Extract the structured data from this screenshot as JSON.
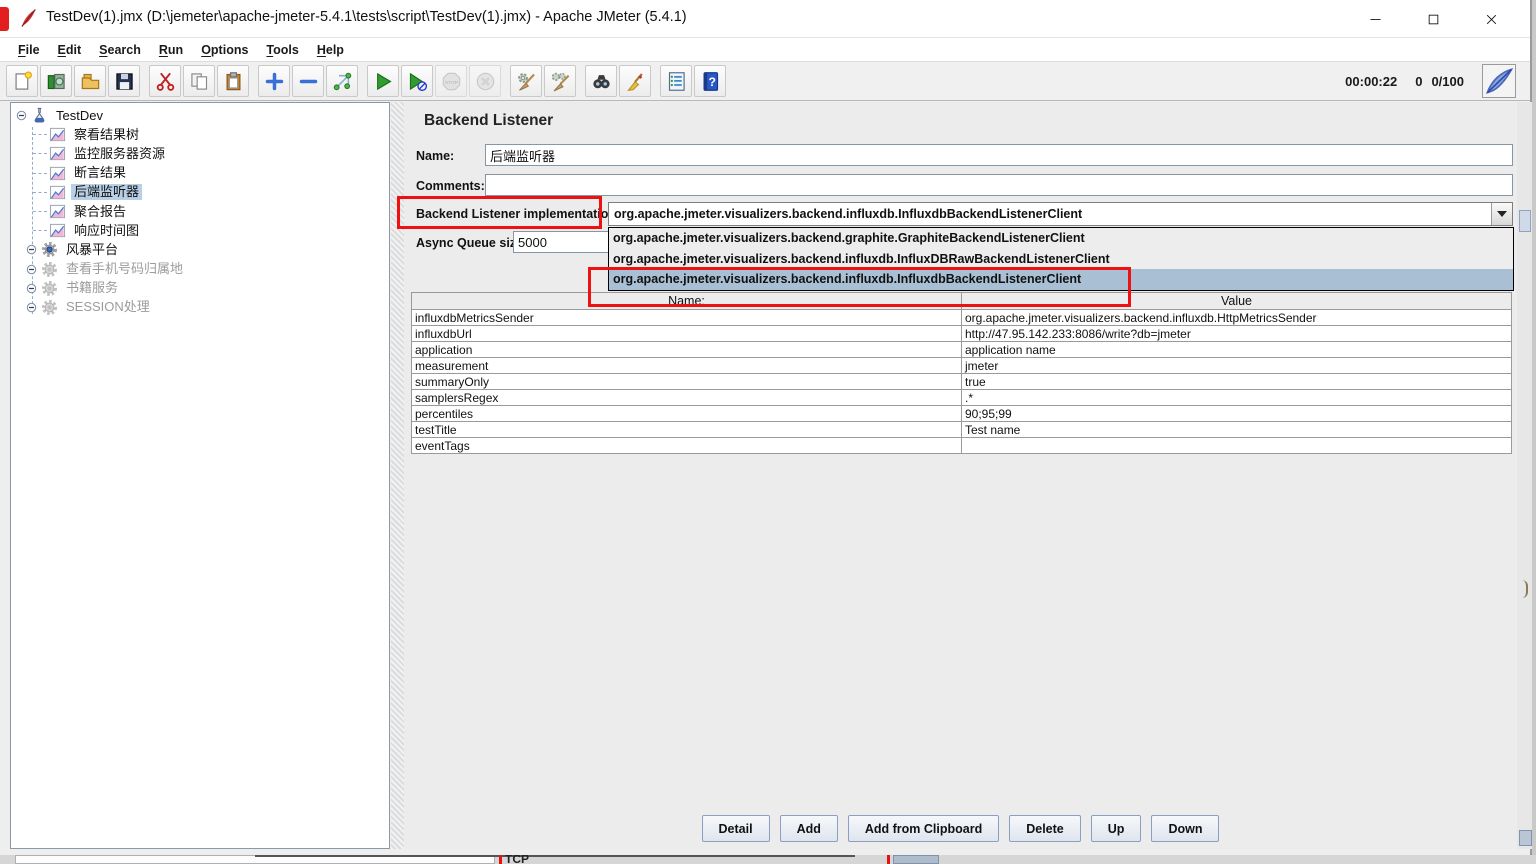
{
  "window": {
    "title": "TestDev(1).jmx (D:\\jemeter\\apache-jmeter-5.4.1\\tests\\script\\TestDev(1).jmx) - Apache JMeter (5.4.1)"
  },
  "menu": {
    "items": [
      "File",
      "Edit",
      "Search",
      "Run",
      "Options",
      "Tools",
      "Help"
    ]
  },
  "toolbar": {
    "groups": [
      [
        "new",
        "templates",
        "open",
        "save"
      ],
      [
        "cut",
        "copy",
        "paste"
      ],
      [
        "expand",
        "collapse",
        "toggle"
      ],
      [
        "start",
        "start-no-timers",
        "stop",
        "shutdown"
      ],
      [
        "clear",
        "clear-all"
      ],
      [
        "search",
        "search-reset"
      ],
      [
        "function-helper",
        "help"
      ]
    ],
    "disabled_icons": [
      "stop",
      "shutdown"
    ],
    "elapsed_time": "00:00:22",
    "warning_count": "0",
    "thread_status": "0/100"
  },
  "tree": {
    "items": [
      {
        "label": "TestDev",
        "icon": "test-plan",
        "kind": "root"
      },
      {
        "label": "察看结果树",
        "icon": "listener-chart",
        "kind": "leaf"
      },
      {
        "label": "监控服务器资源",
        "icon": "listener-chart",
        "kind": "leaf"
      },
      {
        "label": "断言结果",
        "icon": "listener-chart",
        "kind": "leaf"
      },
      {
        "label": "后端监听器",
        "icon": "listener-chart",
        "kind": "leaf",
        "selected": true
      },
      {
        "label": "聚合报告",
        "icon": "listener-chart",
        "kind": "leaf"
      },
      {
        "label": "响应时间图",
        "icon": "listener-chart",
        "kind": "leaf"
      },
      {
        "label": "风暴平台",
        "icon": "gear-enabled",
        "kind": "branch"
      },
      {
        "label": "查看手机号码归属地",
        "icon": "gear-disabled",
        "kind": "branch",
        "disabled": true
      },
      {
        "label": "书籍服务",
        "icon": "gear-disabled",
        "kind": "branch",
        "disabled": true
      },
      {
        "label": "SESSION处理",
        "icon": "gear-disabled",
        "kind": "branch",
        "disabled": true
      }
    ]
  },
  "main": {
    "title": "Backend Listener",
    "name": {
      "label": "Name:",
      "value": "后端监听器"
    },
    "comments": {
      "label": "Comments:",
      "value": ""
    },
    "implementation": {
      "label": "Backend Listener implementation",
      "value": "org.apache.jmeter.visualizers.backend.influxdb.InfluxdbBackendListenerClient",
      "options": [
        "org.apache.jmeter.visualizers.backend.graphite.GraphiteBackendListenerClient",
        "org.apache.jmeter.visualizers.backend.influxdb.InfluxDBRawBackendListenerClient",
        "org.apache.jmeter.visualizers.backend.influxdb.InfluxdbBackendListenerClient"
      ],
      "selected_index": 2
    },
    "async_queue": {
      "label": "Async Queue size",
      "value": "5000"
    },
    "parameters_table": {
      "headers": [
        "Name:",
        "Value"
      ],
      "rows": [
        [
          "influxdbMetricsSender",
          "org.apache.jmeter.visualizers.backend.influxdb.HttpMetricsSender"
        ],
        [
          "influxdbUrl",
          "http://47.95.142.233:8086/write?db=jmeter"
        ],
        [
          "application",
          "application name"
        ],
        [
          "measurement",
          "jmeter"
        ],
        [
          "summaryOnly",
          "true"
        ],
        [
          "samplersRegex",
          ".*"
        ],
        [
          "percentiles",
          "90;95;99"
        ],
        [
          "testTitle",
          "Test name"
        ],
        [
          "eventTags",
          ""
        ]
      ]
    },
    "action_buttons": [
      "Detail",
      "Add",
      "Add from Clipboard",
      "Delete",
      "Up",
      "Down"
    ]
  },
  "colors": {
    "tree_selection": "#b8cfe5",
    "dropdown_selection": "#a9c0d4",
    "annotation_red": "#ee1111"
  },
  "background_window": {
    "visible_text": "TCP"
  }
}
